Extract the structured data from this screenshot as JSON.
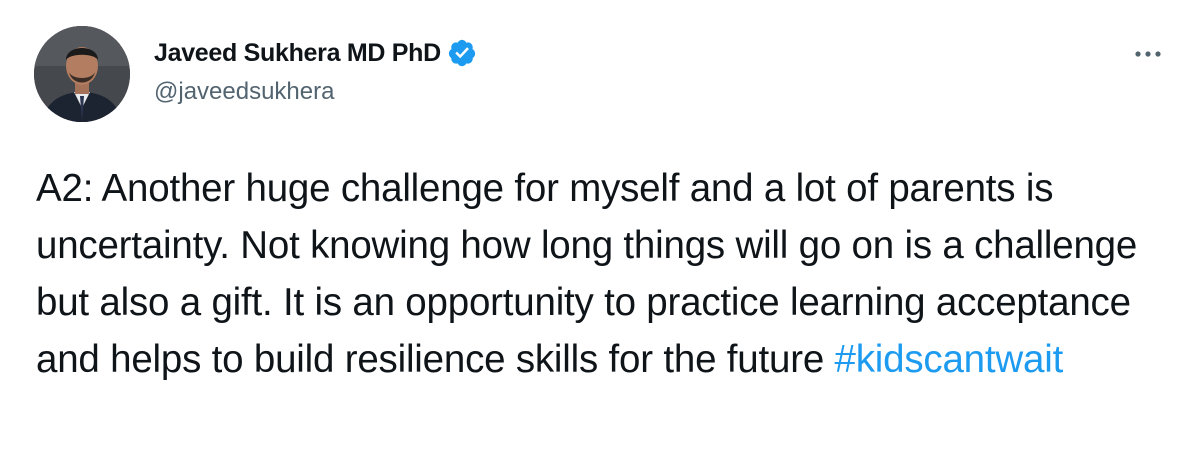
{
  "author": {
    "display_name": "Javeed Sukhera MD PhD",
    "handle": "@javeedsukhera",
    "verified": true,
    "avatar_icon": "profile-photo"
  },
  "tweet": {
    "text": "A2: Another huge challenge for myself and a lot of parents is uncertainty. Not knowing how long things will go on is a challenge but also a gift. It is an opportunity to practice learning acceptance and helps to build resilience skills for the future ",
    "hashtag": "#kidscantwait"
  },
  "icons": {
    "verified": "verified-badge-icon",
    "more": "more-options-icon"
  },
  "colors": {
    "text": "#0f1419",
    "secondary": "#536471",
    "accent": "#1d9bf0",
    "background": "#ffffff"
  }
}
